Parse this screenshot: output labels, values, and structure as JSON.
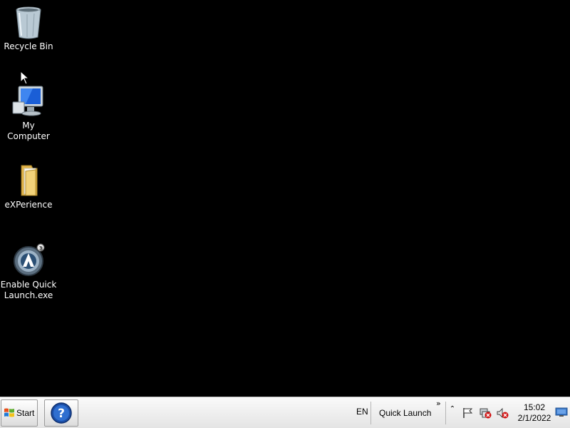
{
  "desktop": {
    "icons": [
      {
        "label": "Recycle Bin",
        "icon": "recycle-bin-icon"
      },
      {
        "label": "My Computer",
        "icon": "computer-monitor-icon"
      },
      {
        "label": "eXPerience",
        "icon": "folder-icon"
      },
      {
        "label": "Enable Quick Launch.exe",
        "icon": "app-launcher-icon"
      }
    ]
  },
  "taskbar": {
    "start_label": "Start",
    "help_icon": "help-question-icon",
    "language": "EN",
    "quick_launch_label": "Quick Launch",
    "quick_launch_chevron": "»",
    "tray_expand": "⌃",
    "tray_icons": [
      "action-center-flag-icon",
      "network-disconnected-icon",
      "volume-muted-icon"
    ],
    "clock_time": "15:02",
    "clock_date": "2/1/2022",
    "show_desktop_icon": "show-desktop-icon"
  },
  "colors": {
    "desktop_background": "#000000",
    "taskbar_background": "#eeeeee",
    "help_blue": "#1c4fa8",
    "alert_red": "#d01010"
  }
}
